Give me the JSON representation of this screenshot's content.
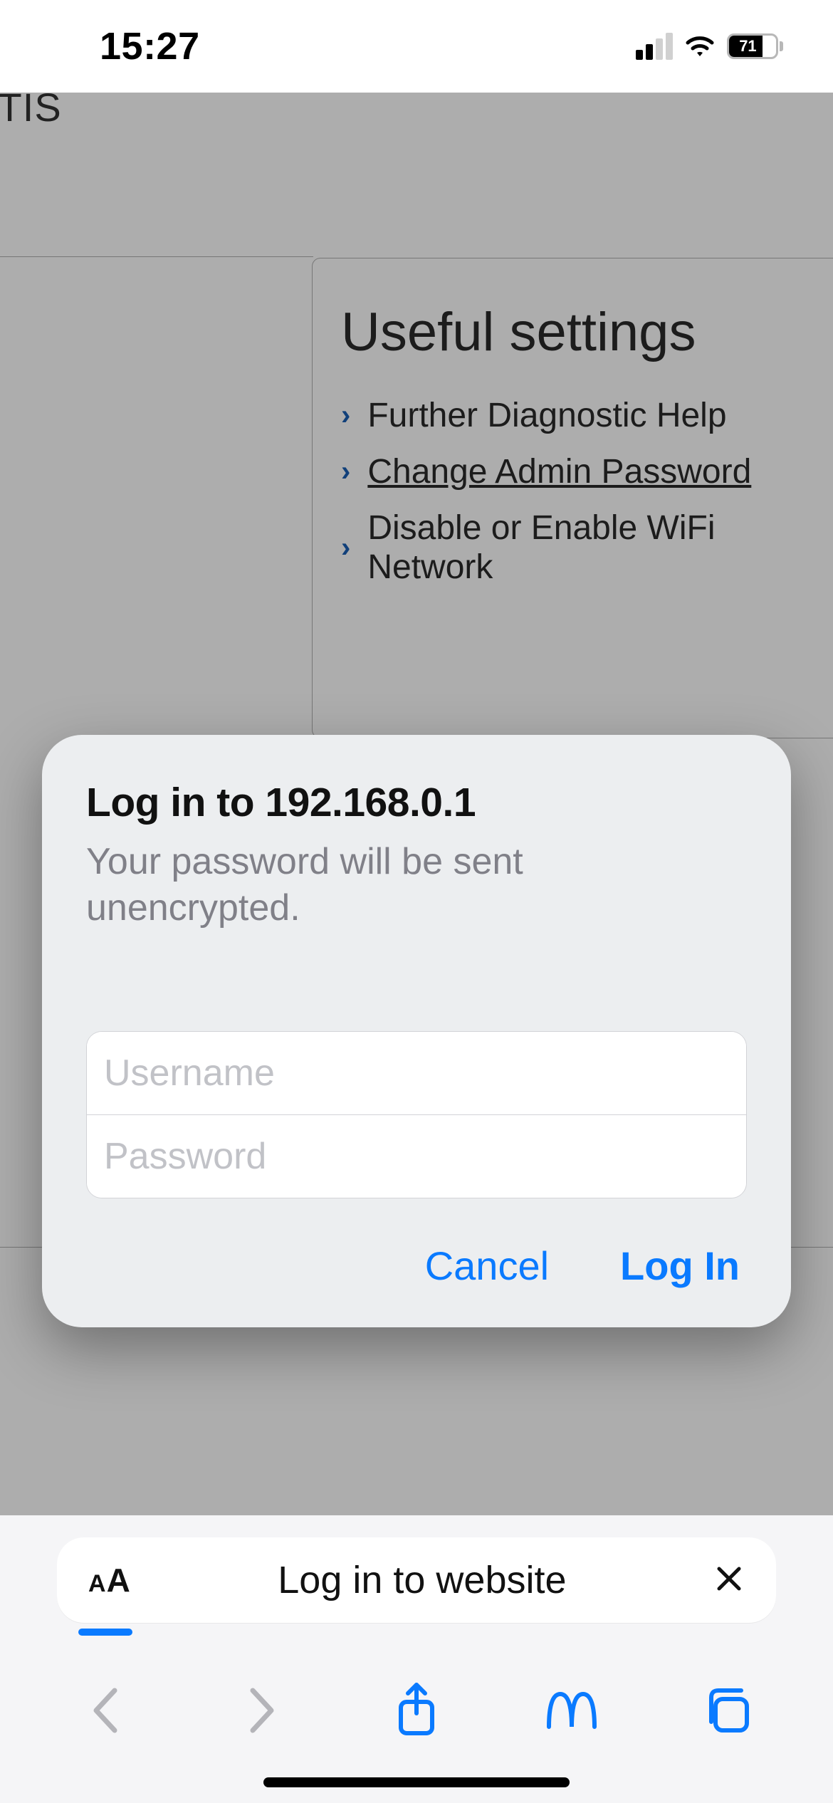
{
  "status": {
    "time": "15:27",
    "battery_pct": "71",
    "battery_fill": 71,
    "cell_active_bars": 2
  },
  "page": {
    "header_fragment": "ITIS",
    "settings": {
      "title": "Useful settings",
      "items": [
        {
          "label": "Further Diagnostic Help",
          "underline": false
        },
        {
          "label": "Change Admin Password",
          "underline": true
        },
        {
          "label": "Disable or Enable WiFi Network",
          "underline": false
        }
      ]
    }
  },
  "auth": {
    "title": "Log in to 192.168.0.1",
    "subtitle": "Your password will be sent unencrypted.",
    "username_placeholder": "Username",
    "password_placeholder": "Password",
    "cancel": "Cancel",
    "login": "Log In"
  },
  "chrome": {
    "aa": "AA",
    "url_label": "Log in to website"
  }
}
